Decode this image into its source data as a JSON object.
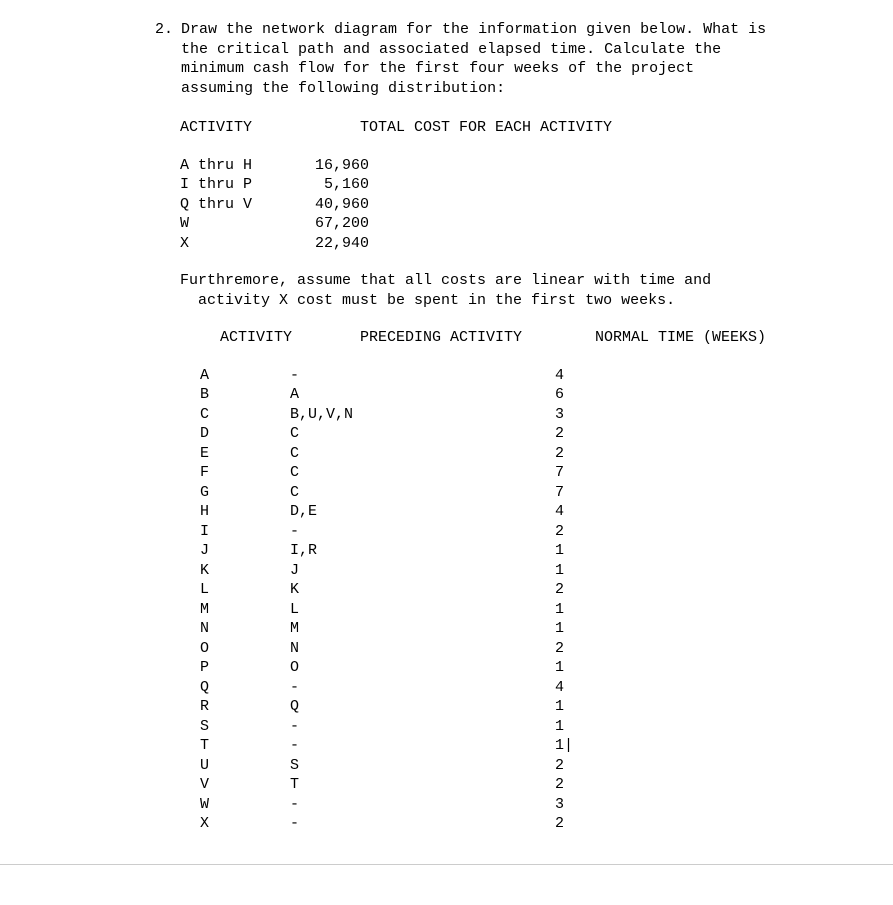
{
  "question": {
    "number": "2.",
    "text_line1": "Draw the network diagram for the information given below. What is",
    "text_line2": "the critical path and associated elapsed time. Calculate the",
    "text_line3": "minimum cash flow for the first four weeks of the project",
    "text_line4": "assuming the following distribution:"
  },
  "cost_header": {
    "col1": "ACTIVITY",
    "col2": "TOTAL COST FOR EACH ACTIVITY"
  },
  "costs": [
    {
      "label": "A thru H",
      "value": "16,960"
    },
    {
      "label": "I thru P",
      "value": " 5,160"
    },
    {
      "label": "Q thru V",
      "value": "40,960"
    },
    {
      "label": "W",
      "value": "67,200"
    },
    {
      "label": "X",
      "value": "22,940"
    }
  ],
  "furthermore": {
    "line1": "Furthremore, assume that all costs are linear with time and",
    "line2": "activity X cost must be spent in the first two weeks."
  },
  "activity_header": {
    "col1": "ACTIVITY",
    "col2": "PRECEDING ACTIVITY",
    "col3": "NORMAL TIME (WEEKS)"
  },
  "activities": [
    {
      "name": "A",
      "preceding": "-",
      "time": "4"
    },
    {
      "name": "B",
      "preceding": "A",
      "time": "6"
    },
    {
      "name": "C",
      "preceding": "B,U,V,N",
      "time": "3"
    },
    {
      "name": "D",
      "preceding": "C",
      "time": "2"
    },
    {
      "name": "E",
      "preceding": "C",
      "time": "2"
    },
    {
      "name": "F",
      "preceding": "C",
      "time": "7"
    },
    {
      "name": "G",
      "preceding": "C",
      "time": "7"
    },
    {
      "name": "H",
      "preceding": "D,E",
      "time": "4"
    },
    {
      "name": "I",
      "preceding": "-",
      "time": "2"
    },
    {
      "name": "J",
      "preceding": "I,R",
      "time": "1"
    },
    {
      "name": "K",
      "preceding": "J",
      "time": "1"
    },
    {
      "name": "L",
      "preceding": "K",
      "time": "2"
    },
    {
      "name": "M",
      "preceding": "L",
      "time": "1"
    },
    {
      "name": "N",
      "preceding": "M",
      "time": "1"
    },
    {
      "name": "O",
      "preceding": "N",
      "time": "2"
    },
    {
      "name": "P",
      "preceding": "O",
      "time": "1"
    },
    {
      "name": "Q",
      "preceding": "-",
      "time": "4"
    },
    {
      "name": "R",
      "preceding": "Q",
      "time": "1"
    },
    {
      "name": "S",
      "preceding": "-",
      "time": "1"
    },
    {
      "name": "T",
      "preceding": "-",
      "time": "1|"
    },
    {
      "name": "U",
      "preceding": "S",
      "time": "2"
    },
    {
      "name": "V",
      "preceding": "T",
      "time": "2"
    },
    {
      "name": "W",
      "preceding": "-",
      "time": "3"
    },
    {
      "name": "X",
      "preceding": "-",
      "time": "2"
    }
  ]
}
